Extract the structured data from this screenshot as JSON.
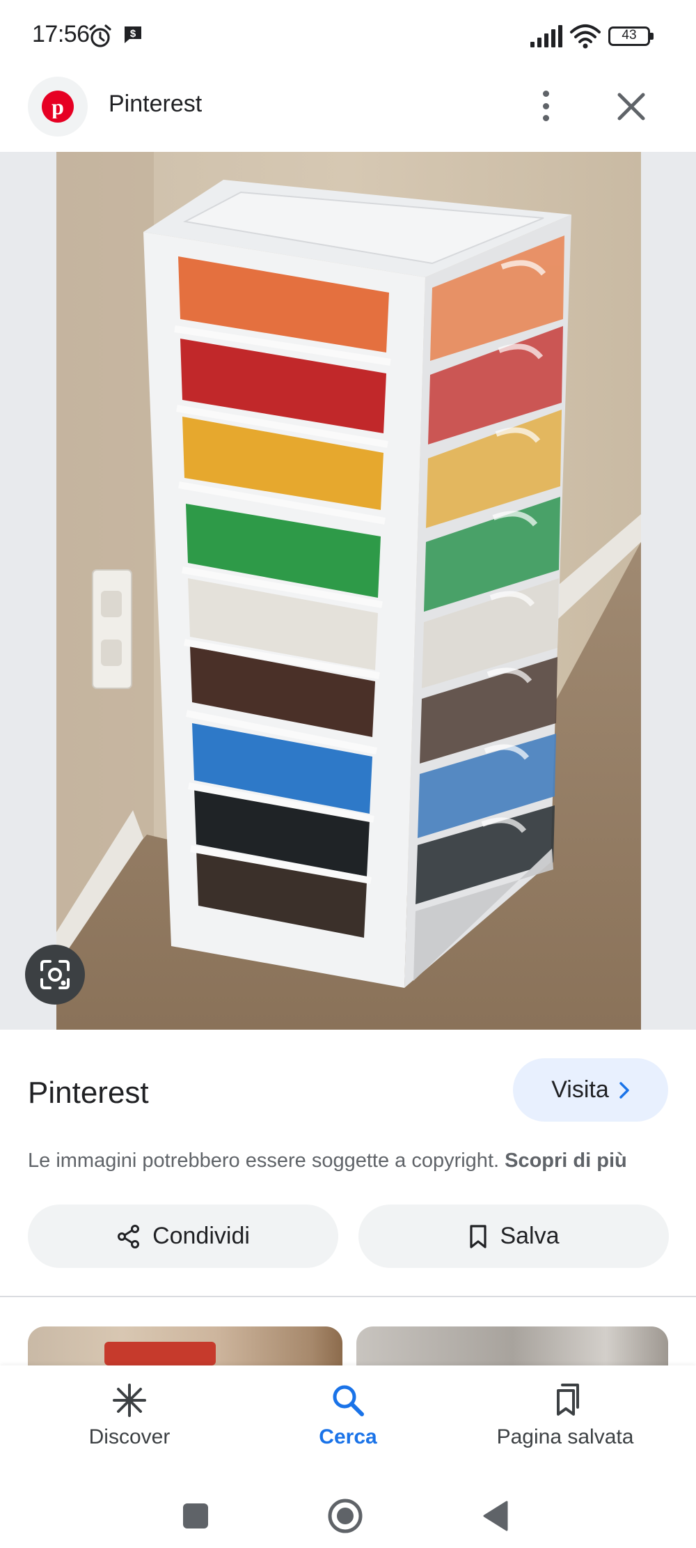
{
  "status_bar": {
    "time": "17:56",
    "battery": "43",
    "icons": [
      "alarm-icon",
      "dollar-notification-icon",
      "signal-icon",
      "wifi-icon",
      "battery-icon"
    ]
  },
  "header": {
    "title": "Pinterest",
    "logo_icon": "pinterest-logo",
    "more_icon": "more-vertical-icon",
    "close_icon": "close-icon"
  },
  "image": {
    "subject": "Stacked plastic drawers filled with LEGO bricks sorted by colour",
    "lens_icon": "google-lens-icon"
  },
  "info": {
    "source": "Pinterest",
    "visit_label": "Visita",
    "copyright_text": "Le immagini potrebbero essere soggette a copyright.",
    "copyright_link": "Scopri di più"
  },
  "actions": {
    "share_label": "Condividi",
    "save_label": "Salva"
  },
  "bottom_nav": {
    "items": [
      {
        "label": "Discover",
        "icon": "asterisk-icon",
        "active": false
      },
      {
        "label": "Cerca",
        "icon": "search-icon",
        "active": true
      },
      {
        "label": "Pagina salvata",
        "icon": "bookmarks-icon",
        "active": false
      }
    ]
  },
  "colors": {
    "accent": "#1a73e8",
    "visit_button_bg": "#e8f0fe",
    "pill_bg": "#f1f3f4",
    "pinterest_red": "#e60023"
  }
}
